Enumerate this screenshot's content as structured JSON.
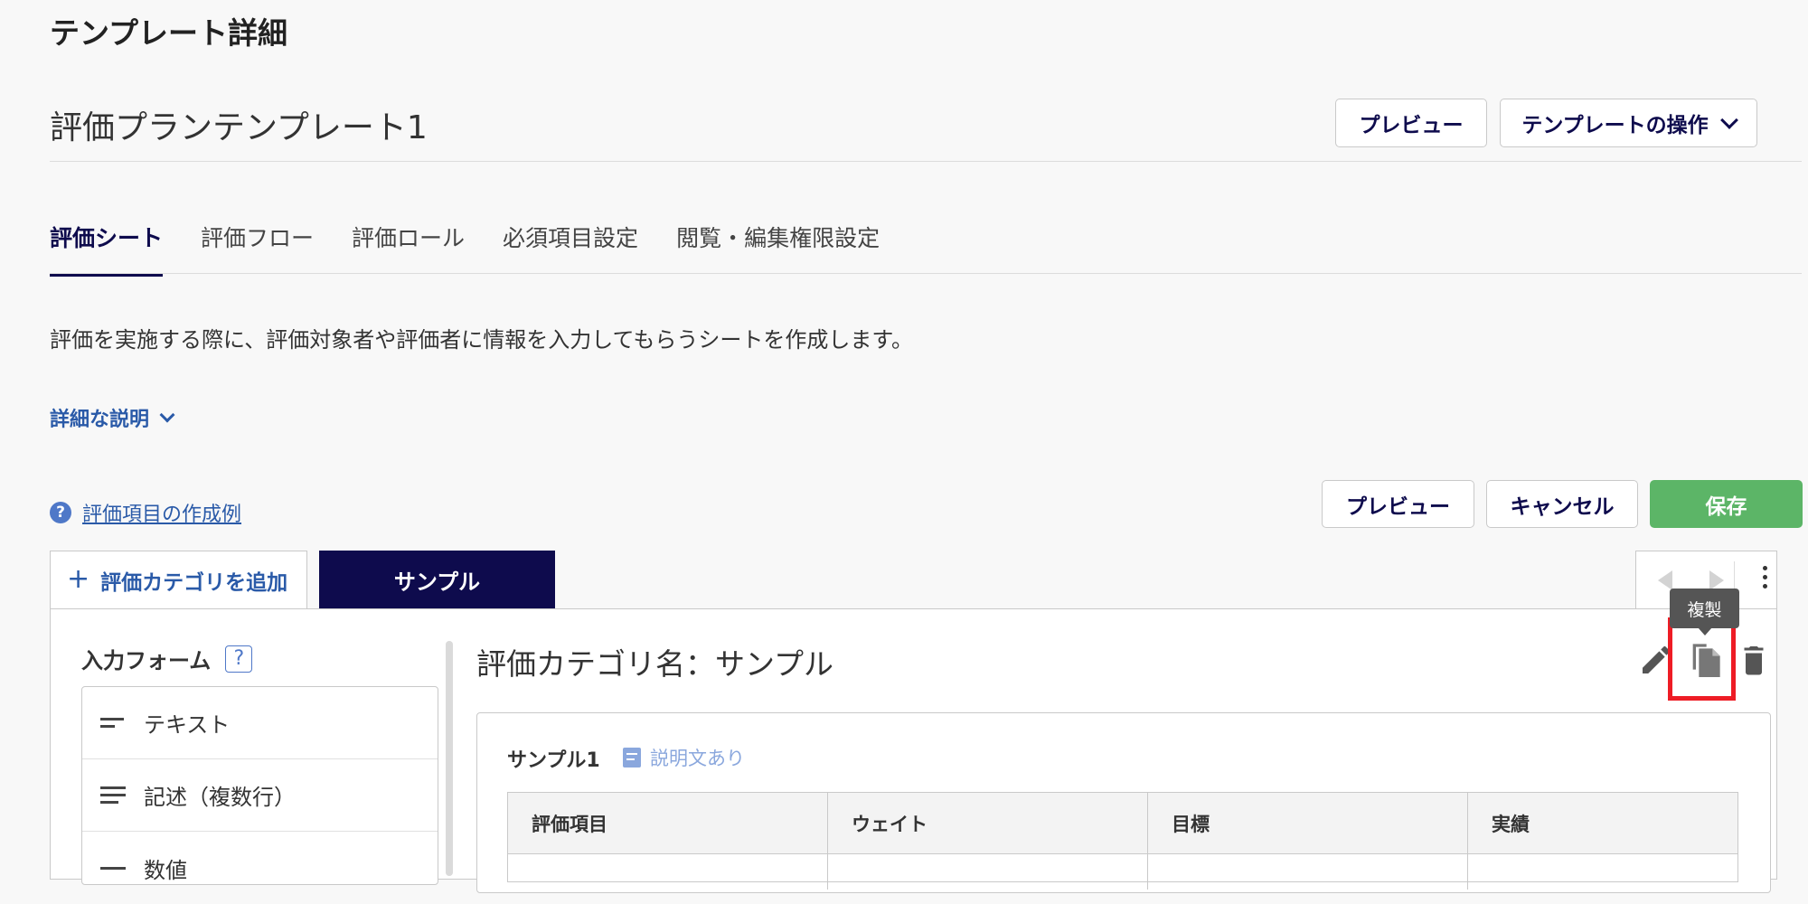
{
  "page": {
    "title": "テンプレート詳細",
    "template_name": "評価プランテンプレート1"
  },
  "header_actions": {
    "preview_label": "プレビュー",
    "operations_label": "テンプレートの操作"
  },
  "tabs": [
    {
      "label": "評価シート",
      "active": true
    },
    {
      "label": "評価フロー",
      "active": false
    },
    {
      "label": "評価ロール",
      "active": false
    },
    {
      "label": "必須項目設定",
      "active": false
    },
    {
      "label": "閲覧・編集権限設定",
      "active": false
    }
  ],
  "sheet": {
    "description": "評価を実施する際に、評価対象者や評価者に情報を入力してもらうシートを作成します。",
    "details_toggle": "詳細な説明",
    "help_link": "評価項目の作成例",
    "preview_label": "プレビュー",
    "cancel_label": "キャンセル",
    "save_label": "保存",
    "add_category_label": "評価カテゴリを追加",
    "add_category_icon": "+",
    "category_tab_label": "サンプル"
  },
  "form_panel": {
    "title": "入力フォーム",
    "help_icon": "?",
    "items": [
      {
        "label": "テキスト",
        "icon": "text-icon"
      },
      {
        "label": "記述（複数行）",
        "icon": "multiline-text-icon"
      },
      {
        "label": "数値",
        "icon": "number-icon"
      }
    ]
  },
  "category": {
    "title": "評価カテゴリ名：サンプル",
    "tooltip": "複製",
    "section_title": "サンプル1",
    "section_badge": "説明文あり",
    "table_headers": [
      "評価項目",
      "ウェイト",
      "目標",
      "実績"
    ]
  },
  "colors": {
    "brand_navy": "#0e0b4d",
    "save_green": "#5cb567",
    "link_blue": "#2a5aa8",
    "highlight_red": "#ee1c25"
  }
}
